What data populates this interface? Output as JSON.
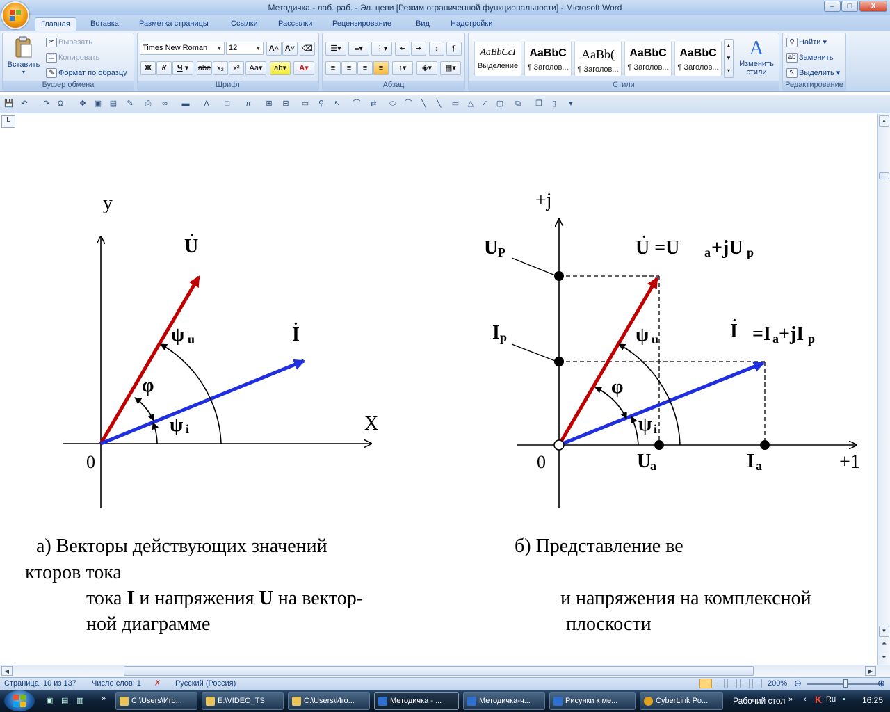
{
  "window": {
    "title": "Методичка - лаб. раб. - Эл. цепи [Режим ограниченной функциональности] - Microsoft Word",
    "minimize": "–",
    "maximize": "□",
    "close": "X"
  },
  "tabs": [
    "Главная",
    "Вставка",
    "Разметка страницы",
    "Ссылки",
    "Рассылки",
    "Рецензирование",
    "Вид",
    "Надстройки"
  ],
  "ribbon": {
    "clipboard": {
      "label": "Буфер обмена",
      "paste": "Вставить",
      "cut": "Вырезать",
      "copy": "Копировать",
      "format_painter": "Формат по образцу"
    },
    "font": {
      "label": "Шрифт",
      "font_name": "Times New Roman",
      "font_size": "12"
    },
    "paragraph": {
      "label": "Абзац"
    },
    "styles": {
      "label": "Стили",
      "items": [
        {
          "sample": "AaBbCcI",
          "name": "Выделение"
        },
        {
          "sample": "AaBbC",
          "name": "¶ Заголов..."
        },
        {
          "sample": "AaBb(",
          "name": "¶ Заголов..."
        },
        {
          "sample": "AaBbC",
          "name": "¶ Заголов..."
        },
        {
          "sample": "AaBbC",
          "name": "¶ Заголов..."
        }
      ],
      "change_styles_1": "Изменить",
      "change_styles_2": "стили"
    },
    "editing": {
      "label": "Редактирование",
      "find": "Найти",
      "replace": "Заменить",
      "select": "Выделить"
    }
  },
  "ruler_corner": "L",
  "diagram_a": {
    "y_axis": "y",
    "x_axis": "X",
    "origin": "0",
    "u_vec": "U",
    "i_vec": "I",
    "psi_u": "ψ",
    "psi_u_sub": "u",
    "psi_i": "ψ",
    "psi_i_sub": "i",
    "phi": "φ"
  },
  "diagram_b": {
    "j_axis": "+j",
    "real_axis": "+1",
    "origin": "0",
    "up_label": "U",
    "up_sub": "P",
    "ip_label": "I",
    "ip_sub": "p",
    "u_eq_1": "U =U",
    "u_eq_sub_a": "a",
    "u_eq_2": "+jU",
    "u_eq_sub_p": "p",
    "i_eq_1": "I",
    "i_eq_2": "=I",
    "i_eq_sub_a": "a",
    "i_eq_3": "+jI",
    "i_eq_sub_p": "p",
    "psi_u": "ψ",
    "psi_u_sub": "u",
    "psi_i": "ψ",
    "psi_i_sub": "i",
    "phi": "φ",
    "ua_label": "U",
    "ua_sub": "a",
    "ia_label": "I",
    "ia_sub": "a"
  },
  "captions": {
    "a_line1": "а)  Векторы действующих значений",
    "a_line2": "кторов тока",
    "a_line3_pre": "тока ",
    "a_line3_I": "I",
    "a_line3_mid": " и напряжения ",
    "a_line3_U": "U",
    "a_line3_post": " на вектор-",
    "a_line4": "ной диаграмме",
    "b_line1": "б)  Представление ве",
    "b_line3": "и напряжения на комплексной",
    "b_line4": "плоскости"
  },
  "status": {
    "page": "Страница: 10 из 137",
    "words": "Число слов: 1",
    "lang": "Русский (Россия)",
    "zoom": "200%"
  },
  "taskbar": {
    "tasks": [
      "C:\\Users\\Иго...",
      "E:\\VIDEO_TS",
      "C:\\Users\\Иго...",
      "Методичка - ...",
      "Методичка-ч...",
      "Рисунки к ме...",
      "CyberLink Po..."
    ],
    "desktop": "Рабочий стол",
    "lang": "Ru",
    "time": "16:25"
  },
  "colors": {
    "u_vector": "#c00000",
    "i_vector": "#1f2fe0",
    "ribbon_text": "#15428b"
  }
}
